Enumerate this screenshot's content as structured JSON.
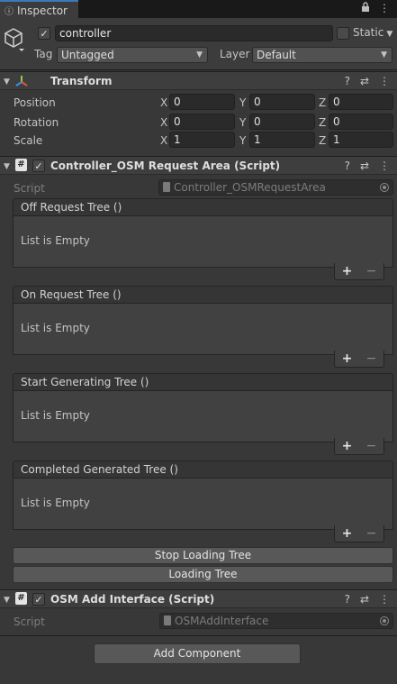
{
  "tab": {
    "title": "Inspector"
  },
  "header": {
    "object_name": "controller",
    "active": true,
    "static_label": "Static",
    "static_checked": false,
    "tag_label": "Tag",
    "tag_value": "Untagged",
    "layer_label": "Layer",
    "layer_value": "Default"
  },
  "transform": {
    "title": "Transform",
    "rows": [
      {
        "label": "Position",
        "x": "0",
        "y": "0",
        "z": "0"
      },
      {
        "label": "Rotation",
        "x": "0",
        "y": "0",
        "z": "0"
      },
      {
        "label": "Scale",
        "x": "1",
        "y": "1",
        "z": "1"
      }
    ],
    "axis": {
      "x": "X",
      "y": "Y",
      "z": "Z"
    }
  },
  "controller": {
    "title": "Controller_OSM Request Area (Script)",
    "enabled": true,
    "script_label": "Script",
    "script_value": "Controller_OSMRequestArea",
    "events": [
      {
        "title": "Off Request Tree ()",
        "empty": "List is Empty"
      },
      {
        "title": "On Request Tree ()",
        "empty": "List is Empty"
      },
      {
        "title": "Start Generating Tree ()",
        "empty": "List is Empty"
      },
      {
        "title": "Completed Generated Tree ()",
        "empty": "List is Empty"
      }
    ],
    "plus": "+",
    "minus": "−",
    "stop_button": "Stop Loading Tree",
    "loading_button": "Loading Tree"
  },
  "osm_add": {
    "title": "OSM Add Interface (Script)",
    "enabled": true,
    "script_label": "Script",
    "script_value": "OSMAddInterface"
  },
  "add_component": "Add Component",
  "icons": {
    "help": "?",
    "settings": "⇄",
    "more": "⋮",
    "lock": "🔒",
    "hash": "#"
  }
}
